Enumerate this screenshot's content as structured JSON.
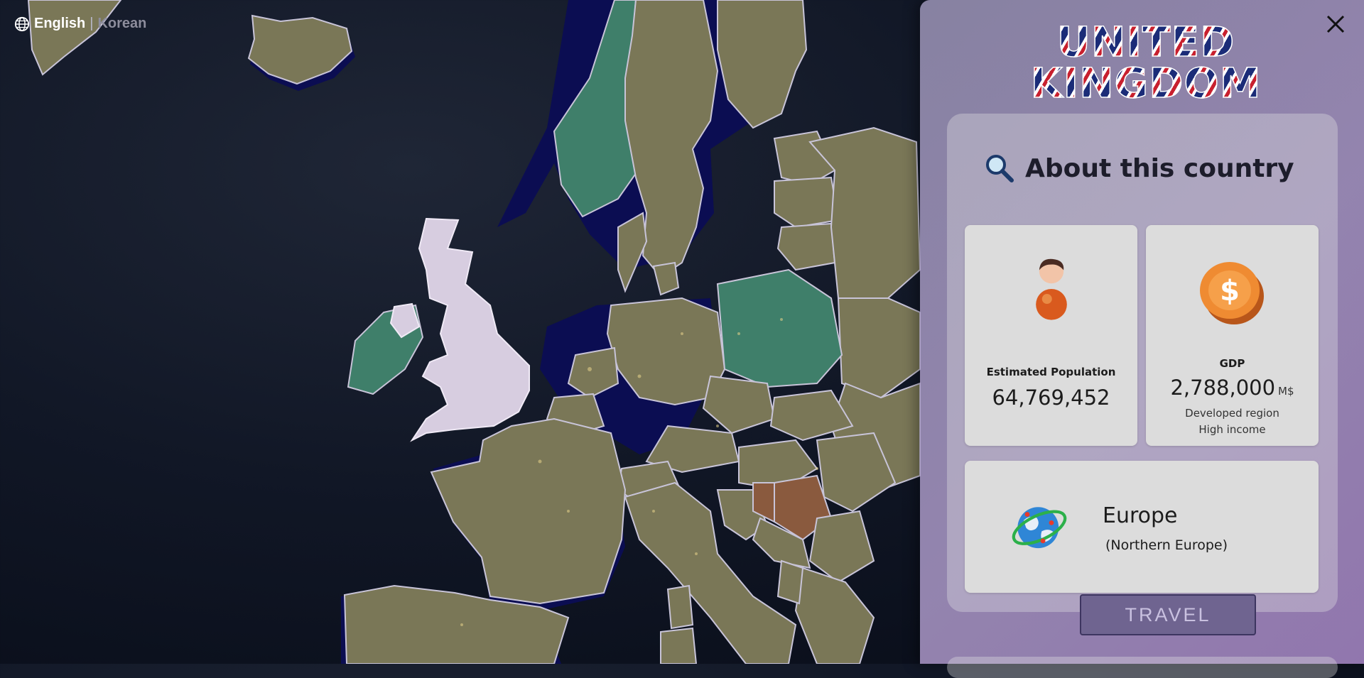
{
  "language": {
    "active": "English",
    "separator": "|",
    "inactive": "Korean"
  },
  "panel": {
    "country_name": "UNITED KINGDOM",
    "about_heading": "About this country",
    "population": {
      "label": "Estimated Population",
      "value": "64,769,452",
      "icon": "person-icon"
    },
    "gdp": {
      "label": "GDP",
      "value": "2,788,000",
      "unit": "M$",
      "region_status": "Developed region",
      "income": "High income",
      "icon": "coin-icon"
    },
    "region": {
      "continent": "Europe",
      "subregion": "(Northern Europe)",
      "icon": "globe-icon"
    },
    "travel_label": "TRAVEL"
  },
  "colors": {
    "panel_bg": "#ab98c8",
    "card_bg": "#dcdcdc",
    "selected_country": "#d7cde0",
    "ocean": "#0f1524",
    "land": "#7a7757",
    "travel_button": "#6f6490"
  }
}
